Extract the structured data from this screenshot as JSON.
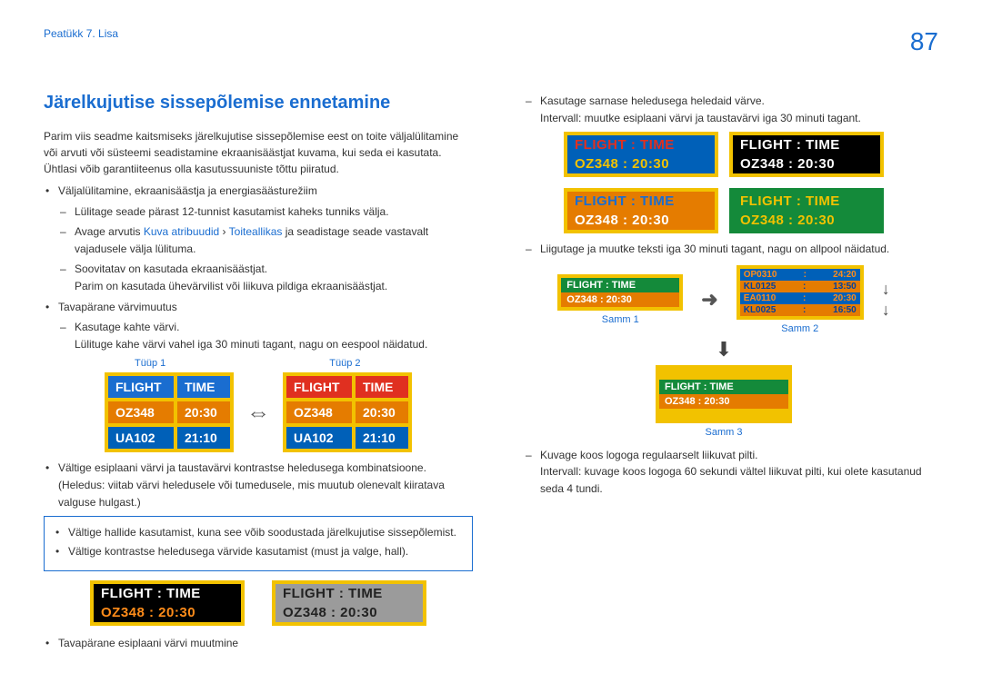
{
  "header": {
    "breadcrumb": "Peatükk 7. Lisa",
    "page": "87"
  },
  "title": "Järelkujutise sissepõlemise ennetamine",
  "left": {
    "intro": "Parim viis seadme kaitsmiseks järelkujutise sissepõlemise eest on toite väljalülitamine või arvuti või süsteemi seadistamine ekraanisäästjat kuvama, kui seda ei kasutata. Ühtlasi võib garantiiteenus olla kasutussuuniste tõttu piiratud.",
    "b1": "Väljalülitamine, ekraanisäästja ja energiasäästurežiim",
    "d1": "Lülitage seade pärast 12-tunnist kasutamist kaheks tunniks välja.",
    "d2a": "Avage arvutis ",
    "d2b": "Kuva atribuudid",
    "d2c": " › ",
    "d2d": "Toiteallikas",
    "d2e": " ja seadistage seade vastavalt vajadusele välja lülituma.",
    "d3a": "Soovitatav on kasutada ekraanisäästjat.",
    "d3b": "Parim on kasutada ühevärvilist või liikuva pildiga ekraanisäästjat.",
    "b2": "Tavapärane värvimuutus",
    "d4a": "Kasutage kahte värvi.",
    "d4b": "Lülituge kahe värvi vahel iga 30 minuti tagant, nagu on eespool näidatud.",
    "type1": "Tüüp 1",
    "type2": "Tüüp 2",
    "tbl": {
      "h1": "FLIGHT",
      "h2": "TIME",
      "r1c1": "OZ348",
      "r1c2": "20:30",
      "r2c1": "UA102",
      "r2c2": "21:10"
    },
    "b3": "Vältige esiplaani värvi ja taustavärvi kontrastse heledusega kombinatsioone. (Heledus: viitab värvi heledusele või tumedusele, mis muutub olenevalt kiiratava valguse hulgast.)",
    "note1": "Vältige hallide kasutamist, kuna see võib soodustada järelkujutise sissepõlemist.",
    "note2": "Vältige kontrastse heledusega värvide kasutamist (must ja valge, hall).",
    "wide": {
      "h": "FLIGHT    :   TIME",
      "d": "OZ348    :   20:30"
    },
    "b4": "Tavapärane esiplaani värvi muutmine"
  },
  "right": {
    "d1a": "Kasutage sarnase heledusega heledaid värve.",
    "d1b": "Intervall: muutke esiplaani värvi ja taustavärvi iga 30 minuti tagant.",
    "wide": {
      "h": "FLIGHT   :   TIME",
      "d": "OZ348   :   20:30"
    },
    "d2": "Liigutage ja muutke teksti iga 30 minuti tagant, nagu on allpool näidatud.",
    "step1": "Samm 1",
    "step2": "Samm 2",
    "step3": "Samm 3",
    "mini": {
      "h": "FLIGHT    :    TIME",
      "d": "OZ348    :    20:30"
    },
    "scroll": {
      "l1a": "OP0310",
      "l1b": "24:20",
      "l2a": "KL0125",
      "l2b": "13:50",
      "l3a": "EA0110",
      "l3b": "20:30",
      "l4a": "KL0025",
      "l4b": "16:50"
    },
    "d3a": "Kuvage koos logoga regulaarselt liikuvat pilti.",
    "d3b": "Intervall: kuvage koos logoga 60 sekundi vältel liikuvat pilti, kui olete kasutanud seda 4 tundi."
  }
}
